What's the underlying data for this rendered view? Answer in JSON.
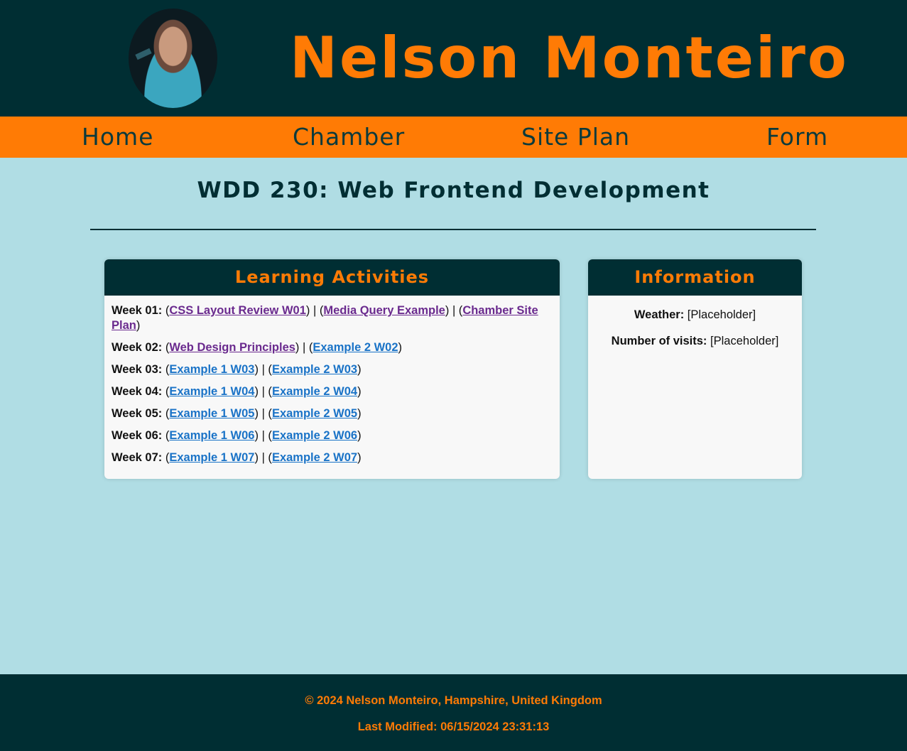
{
  "header": {
    "avatar_alt": "Nelson Monteiro",
    "site_title": "Nelson Monteiro"
  },
  "nav": {
    "items": [
      {
        "label": "Home"
      },
      {
        "label": "Chamber"
      },
      {
        "label": "Site Plan"
      },
      {
        "label": "Form"
      }
    ]
  },
  "main": {
    "course_title": "WDD 230: Web Frontend Development",
    "learning": {
      "heading": "Learning Activities",
      "weeks": [
        {
          "label": "Week 01:",
          "links": [
            "CSS Layout Review W01",
            "Media Query Example",
            "Chamber Site Plan"
          ]
        },
        {
          "label": "Week 02:",
          "links": [
            "Web Design Principles",
            "Example 2 W02"
          ]
        },
        {
          "label": "Week 03:",
          "links": [
            "Example 1 W03",
            "Example 2 W03"
          ]
        },
        {
          "label": "Week 04:",
          "links": [
            "Example 1 W04",
            "Example 2 W04"
          ]
        },
        {
          "label": "Week 05:",
          "links": [
            "Example 1 W05",
            "Example 2 W05"
          ]
        },
        {
          "label": "Week 06:",
          "links": [
            "Example 1 W06",
            "Example 2 W06"
          ]
        },
        {
          "label": "Week 07:",
          "links": [
            "Example 1 W07",
            "Example 2 W07"
          ]
        }
      ]
    },
    "information": {
      "heading": "Information",
      "weather_label": "Weather:",
      "weather_value": "[Placeholder]",
      "visits_label": "Number of visits:",
      "visits_value": "[Placeholder]"
    }
  },
  "footer": {
    "copyright": "© 2024 Nelson Monteiro, Hampshire, United Kingdom",
    "last_modified": "Last Modified: 06/15/2024 23:31:13"
  },
  "colors": {
    "dark": "#002e33",
    "accent": "#ff7b05",
    "background": "#b0dde4",
    "link": "#1a73c7",
    "visited_link": "#6a2a8e"
  }
}
